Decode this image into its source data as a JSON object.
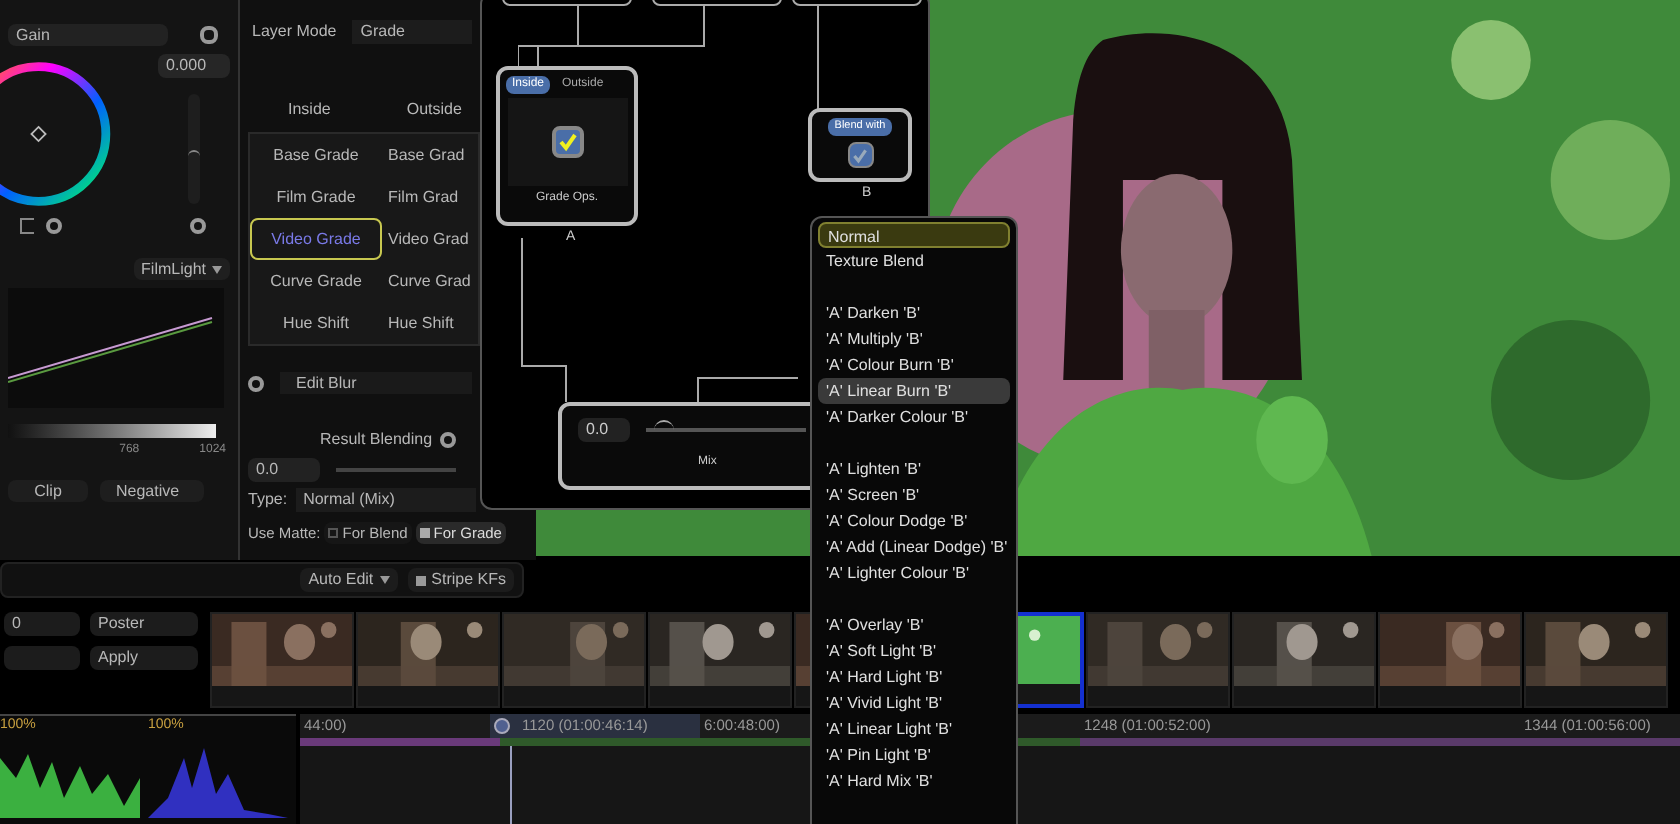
{
  "color_panel": {
    "top_dropdown": "Gain",
    "value": "0.000",
    "slider": {
      "level": 0.5
    },
    "curve_dropdown": "FilmLight",
    "scale_labels": [
      "768",
      "1024"
    ],
    "buttons": [
      "Clip",
      "Negative"
    ]
  },
  "layer_panel": {
    "layer_mode_label": "Layer Mode",
    "layer_mode": "Grade",
    "columns": [
      "Inside",
      "Outside"
    ],
    "rows": [
      {
        "inside": "Base Grade",
        "outside": "Base Grad",
        "selected": false
      },
      {
        "inside": "Film Grade",
        "outside": "Film Grad",
        "selected": false
      },
      {
        "inside": "Video Grade",
        "outside": "Video Grad",
        "selected": true
      },
      {
        "inside": "Curve Grade",
        "outside": "Curve Grad",
        "selected": false
      },
      {
        "inside": "Hue Shift",
        "outside": "Hue Shift",
        "selected": false
      }
    ],
    "edit_blur": "Edit Blur",
    "result_blending": "Result Blending",
    "blend_value": "0.0",
    "type_label": "Type:",
    "type_value": "Normal (Mix)",
    "use_matte_label": "Use Matte:",
    "matte_options": [
      {
        "label": "For Blend",
        "checked": false
      },
      {
        "label": "For Grade",
        "checked": true
      }
    ]
  },
  "node_graph": {
    "grade_node": {
      "tabs": [
        {
          "label": "Inside",
          "selected": true
        },
        {
          "label": "Outside",
          "selected": false
        }
      ],
      "checked": true,
      "label": "Grade Ops.",
      "port": "A"
    },
    "blend_node": {
      "tab": "Blend with",
      "checked": true,
      "port": "B"
    },
    "mix_node": {
      "value": "0.0",
      "level": 0.05,
      "label": "Mix"
    }
  },
  "blend_menu": {
    "groups": [
      {
        "items": [
          {
            "label": "Normal",
            "selected": true,
            "highlighted": false
          },
          {
            "label": "Texture Blend",
            "selected": false,
            "highlighted": false
          }
        ]
      },
      {
        "items": [
          {
            "label": "'A' Darken 'B'",
            "selected": false,
            "highlighted": false
          },
          {
            "label": "'A' Multiply 'B'",
            "selected": false,
            "highlighted": false
          },
          {
            "label": "'A' Colour Burn 'B'",
            "selected": false,
            "highlighted": false
          },
          {
            "label": "'A' Linear Burn 'B'",
            "selected": false,
            "highlighted": true
          },
          {
            "label": "'A' Darker Colour 'B'",
            "selected": false,
            "highlighted": false
          }
        ]
      },
      {
        "items": [
          {
            "label": "'A' Lighten 'B'",
            "selected": false,
            "highlighted": false
          },
          {
            "label": "'A' Screen 'B'",
            "selected": false,
            "highlighted": false
          },
          {
            "label": "'A' Colour Dodge 'B'",
            "selected": false,
            "highlighted": false
          },
          {
            "label": "'A' Add (Linear Dodge) 'B'",
            "selected": false,
            "highlighted": false
          },
          {
            "label": "'A' Lighter Colour 'B'",
            "selected": false,
            "highlighted": false
          }
        ]
      },
      {
        "items": [
          {
            "label": "'A' Overlay 'B'",
            "selected": false,
            "highlighted": false
          },
          {
            "label": "'A' Soft Light 'B'",
            "selected": false,
            "highlighted": false
          },
          {
            "label": "'A' Hard Light 'B'",
            "selected": false,
            "highlighted": false
          },
          {
            "label": "'A' Vivid Light 'B'",
            "selected": false,
            "highlighted": false
          },
          {
            "label": "'A' Linear Light 'B'",
            "selected": false,
            "highlighted": false
          },
          {
            "label": "'A' Pin Light 'B'",
            "selected": false,
            "highlighted": false
          },
          {
            "label": "'A' Hard Mix 'B'",
            "selected": false,
            "highlighted": false
          }
        ]
      }
    ]
  },
  "toolbar": {
    "auto_edit": "Auto Edit",
    "stripe": "Stripe KFs"
  },
  "strip_controls": {
    "frame": "0",
    "mode": "Poster",
    "apply": "Apply"
  },
  "thumbnails": [
    {
      "selected": false
    },
    {
      "selected": false
    },
    {
      "selected": false
    },
    {
      "selected": false
    },
    {
      "selected": false
    },
    {
      "selected": true
    },
    {
      "selected": false
    },
    {
      "selected": false
    },
    {
      "selected": false
    },
    {
      "selected": false
    }
  ],
  "scopes": {
    "labels": [
      "100%",
      "100%"
    ]
  },
  "timeline": {
    "ruler": [
      "44:00)",
      "1120 (01:00:46:14)",
      "6:00:48:00)",
      "1248 (01:00:52:00)",
      "1344 (01:00:56:00)"
    ]
  }
}
